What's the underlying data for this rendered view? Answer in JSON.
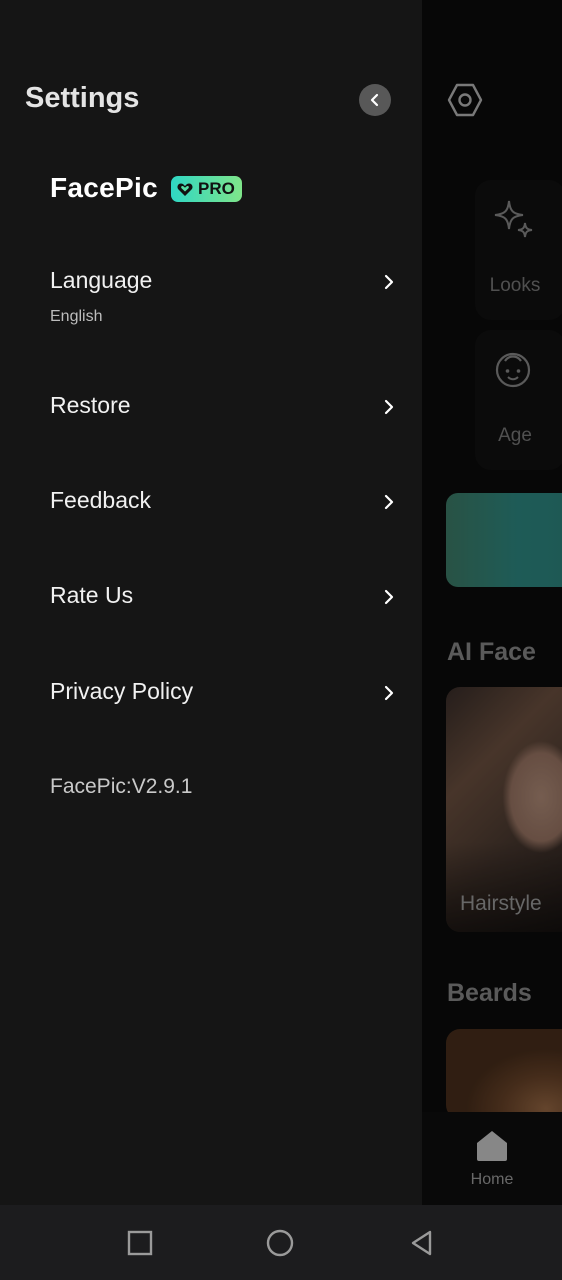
{
  "drawer": {
    "title": "Settings",
    "brand": "FacePic",
    "badge": "PRO",
    "items": [
      {
        "label": "Language",
        "subtitle": "English"
      },
      {
        "label": "Restore"
      },
      {
        "label": "Feedback"
      },
      {
        "label": "Rate Us"
      },
      {
        "label": "Privacy Policy"
      }
    ],
    "version": "FacePic:V2.9.1"
  },
  "background_app": {
    "features": [
      {
        "label": "Looks",
        "icon": "sparkle-icon"
      },
      {
        "label": "Age",
        "icon": "baby-face-icon"
      }
    ],
    "sections": [
      {
        "title": "AI Face",
        "card_caption": "Hairstyle"
      },
      {
        "title": "Beards"
      }
    ],
    "bottom_nav": {
      "home_label": "Home"
    }
  },
  "colors": {
    "drawer_bg": "#151515",
    "accent_gradient_start": "#2fd7c4",
    "accent_gradient_end": "#7fe58a"
  }
}
